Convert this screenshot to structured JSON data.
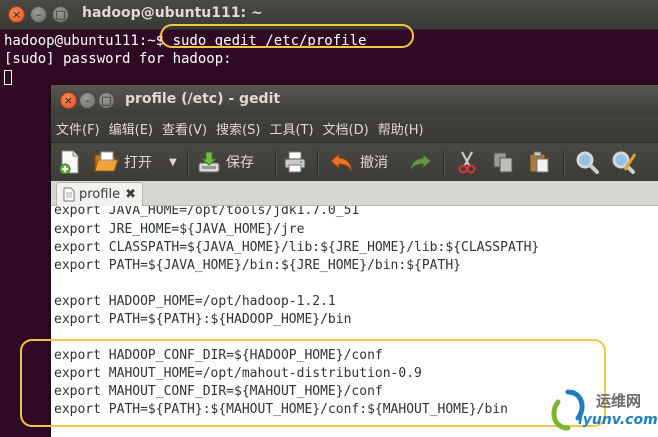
{
  "terminal": {
    "title": "hadoop@ubuntu111: ~",
    "lines": [
      "hadoop@ubuntu111:~$ sudo gedit /etc/profile",
      "[sudo] password for hadoop:"
    ]
  },
  "gedit": {
    "title": "profile (/etc) - gedit",
    "menu": [
      "文件(F)",
      "编辑(E)",
      "查看(V)",
      "搜索(S)",
      "工具(T)",
      "文档(D)",
      "帮助(H)"
    ],
    "toolbar": {
      "new_icon": "new-document-icon",
      "open_label": "打开",
      "save_label": "保存",
      "undo_label": "撤消"
    },
    "tab": {
      "label": "profile",
      "close_glyph": "✖"
    },
    "lines": [
      "export JAVA_HOME=/opt/tools/jdk1.7.0_51",
      "export JRE_HOME=${JAVA_HOME}/jre",
      "export CLASSPATH=${JAVA_HOME}/lib:${JRE_HOME}/lib:${CLASSPATH}",
      "export PATH=${JAVA_HOME}/bin:${JRE_HOME}/bin:${PATH}",
      "",
      "export HADOOP_HOME=/opt/hadoop-1.2.1",
      "export PATH=${PATH}:${HADOOP_HOME}/bin",
      "",
      "export HADOOP_CONF_DIR=${HADOOP_HOME}/conf",
      "export MAHOUT_HOME=/opt/mahout-distribution-0.9",
      "export MAHOUT_CONF_DIR=${MAHOUT_HOME}/conf",
      "export PATH=${PATH}:${MAHOUT_HOME}/conf:${MAHOUT_HOME}/bin"
    ]
  },
  "watermark": {
    "cn": "运维网",
    "en": "iyunv.com"
  },
  "colors": {
    "terminal_bg": "#300a24",
    "highlight": "#f3c641",
    "close_button": "#e2541f"
  }
}
